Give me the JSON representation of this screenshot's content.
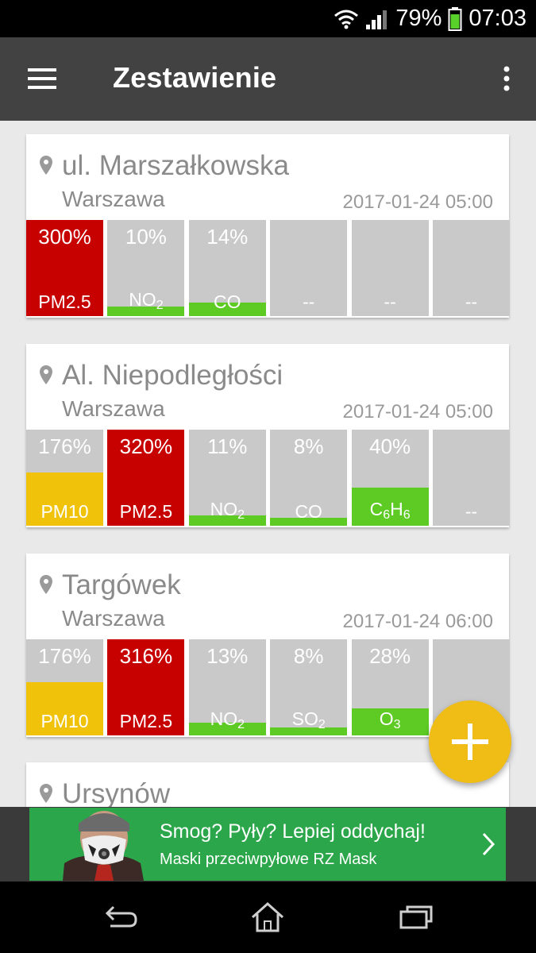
{
  "status_bar": {
    "battery": "79%",
    "time": "07:03"
  },
  "app_bar": {
    "title": "Zestawienie"
  },
  "stations": [
    {
      "name": "ul. Marszałkowska",
      "city": "Warszawa",
      "timestamp": "2017-01-24 05:00",
      "tiles": [
        {
          "pct": "300%",
          "label": "PM2.5",
          "level": 1.0,
          "color": "#c70000"
        },
        {
          "pct": "10%",
          "label": "NO",
          "sub": "2",
          "level": 0.1,
          "color": "#5dcb23"
        },
        {
          "pct": "14%",
          "label": "CO",
          "sub": "",
          "level": 0.14,
          "color": "#5dcb23"
        },
        {
          "pct": "",
          "label": "--",
          "level": 0,
          "color": "#c9c9c9"
        },
        {
          "pct": "",
          "label": "--",
          "level": 0,
          "color": "#c9c9c9"
        },
        {
          "pct": "",
          "label": "--",
          "level": 0,
          "color": "#c9c9c9"
        }
      ]
    },
    {
      "name": "Al. Niepodległości",
      "city": "Warszawa",
      "timestamp": "2017-01-24 05:00",
      "tiles": [
        {
          "pct": "176%",
          "label": "PM10",
          "level": 0.55,
          "color": "#f0c20a"
        },
        {
          "pct": "320%",
          "label": "PM2.5",
          "level": 1.0,
          "color": "#c70000"
        },
        {
          "pct": "11%",
          "label": "NO",
          "sub": "2",
          "level": 0.11,
          "color": "#5dcb23"
        },
        {
          "pct": "8%",
          "label": "CO",
          "sub": "",
          "level": 0.08,
          "color": "#5dcb23"
        },
        {
          "pct": "40%",
          "label": "C",
          "sub": "6",
          "label2": "H",
          "sub2": "6",
          "level": 0.4,
          "color": "#5dcb23"
        },
        {
          "pct": "",
          "label": "--",
          "level": 0,
          "color": "#c9c9c9"
        }
      ]
    },
    {
      "name": "Targówek",
      "city": "Warszawa",
      "timestamp": "2017-01-24 06:00",
      "tiles": [
        {
          "pct": "176%",
          "label": "PM10",
          "level": 0.55,
          "color": "#f0c20a"
        },
        {
          "pct": "316%",
          "label": "PM2.5",
          "level": 1.0,
          "color": "#c70000"
        },
        {
          "pct": "13%",
          "label": "NO",
          "sub": "2",
          "level": 0.13,
          "color": "#5dcb23"
        },
        {
          "pct": "8%",
          "label": "SO",
          "sub": "2",
          "level": 0.08,
          "color": "#5dcb23"
        },
        {
          "pct": "28%",
          "label": "O",
          "sub": "3",
          "level": 0.28,
          "color": "#5dcb23"
        },
        {
          "pct": "",
          "label": "",
          "level": 0,
          "color": "#c9c9c9"
        }
      ]
    },
    {
      "name": "Ursynów",
      "city": "",
      "timestamp": "",
      "tiles": []
    }
  ],
  "ad": {
    "line1": "Smog? Pyły? Lepiej oddychaj!",
    "line2": "Maski przeciwpyłowe RZ Mask"
  },
  "icons": {
    "menu": "hamburger-menu-icon",
    "overflow": "overflow-menu-icon",
    "pin": "location-pin-icon",
    "fab": "plus-icon",
    "back": "back-icon",
    "home": "home-icon",
    "recents": "recent-apps-icon"
  }
}
